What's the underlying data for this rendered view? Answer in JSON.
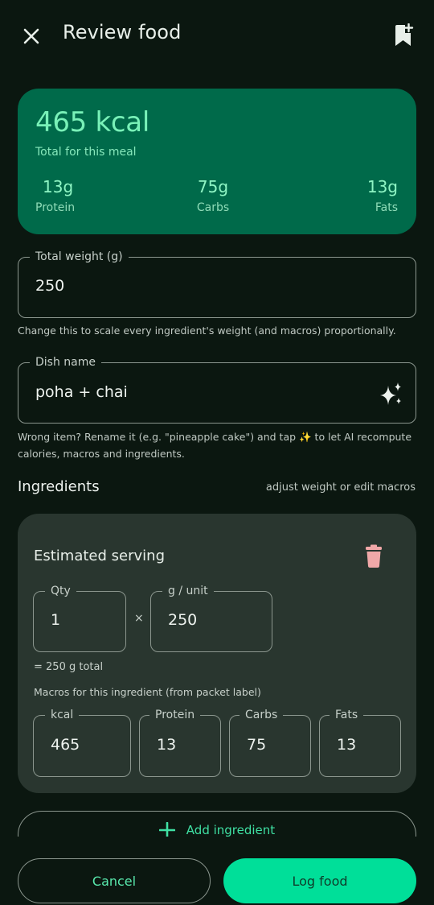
{
  "header": {
    "title": "Review food",
    "close_icon": "close-icon",
    "bookmark_icon": "bookmark-add-icon"
  },
  "summary": {
    "kcal": "465 kcal",
    "subtitle": "Total for this meal",
    "protein": {
      "value": "13g",
      "label": "Protein"
    },
    "carbs": {
      "value": "75g",
      "label": "Carbs"
    },
    "fats": {
      "value": "13g",
      "label": "Fats"
    }
  },
  "weight": {
    "label": "Total weight (g)",
    "value": "250",
    "helper": "Change this to scale every ingredient's weight (and macros) proportionally."
  },
  "dish": {
    "label": "Dish name",
    "value": "poha + chai",
    "ai_icon": "sparkles-icon",
    "helper": "Wrong item? Rename it (e.g. \"pineapple cake\") and tap ✨ to let AI recompute calories, macros and ingredients."
  },
  "ingredients": {
    "title": "Ingredients",
    "hint": "adjust weight or edit macros",
    "items": [
      {
        "name": "Estimated serving",
        "qty_label": "Qty",
        "qty": "1",
        "times": "×",
        "unit_label": "g / unit",
        "unit": "250",
        "total_note": "= 250 g total",
        "macros_note": "Macros for this ingredient (from packet label)",
        "kcal_label": "kcal",
        "kcal": "465",
        "protein_label": "Protein",
        "protein": "13",
        "carbs_label": "Carbs",
        "carbs": "75",
        "fats_label": "Fats",
        "fats": "13"
      }
    ],
    "add_label": "Add ingredient"
  },
  "actions": {
    "cancel": "Cancel",
    "log": "Log food"
  },
  "colors": {
    "background": "#0b1710",
    "summary_card": "#006a4a",
    "ingredient_card": "#29362f",
    "accent": "#00df99",
    "trash": "#f0a8a8"
  }
}
